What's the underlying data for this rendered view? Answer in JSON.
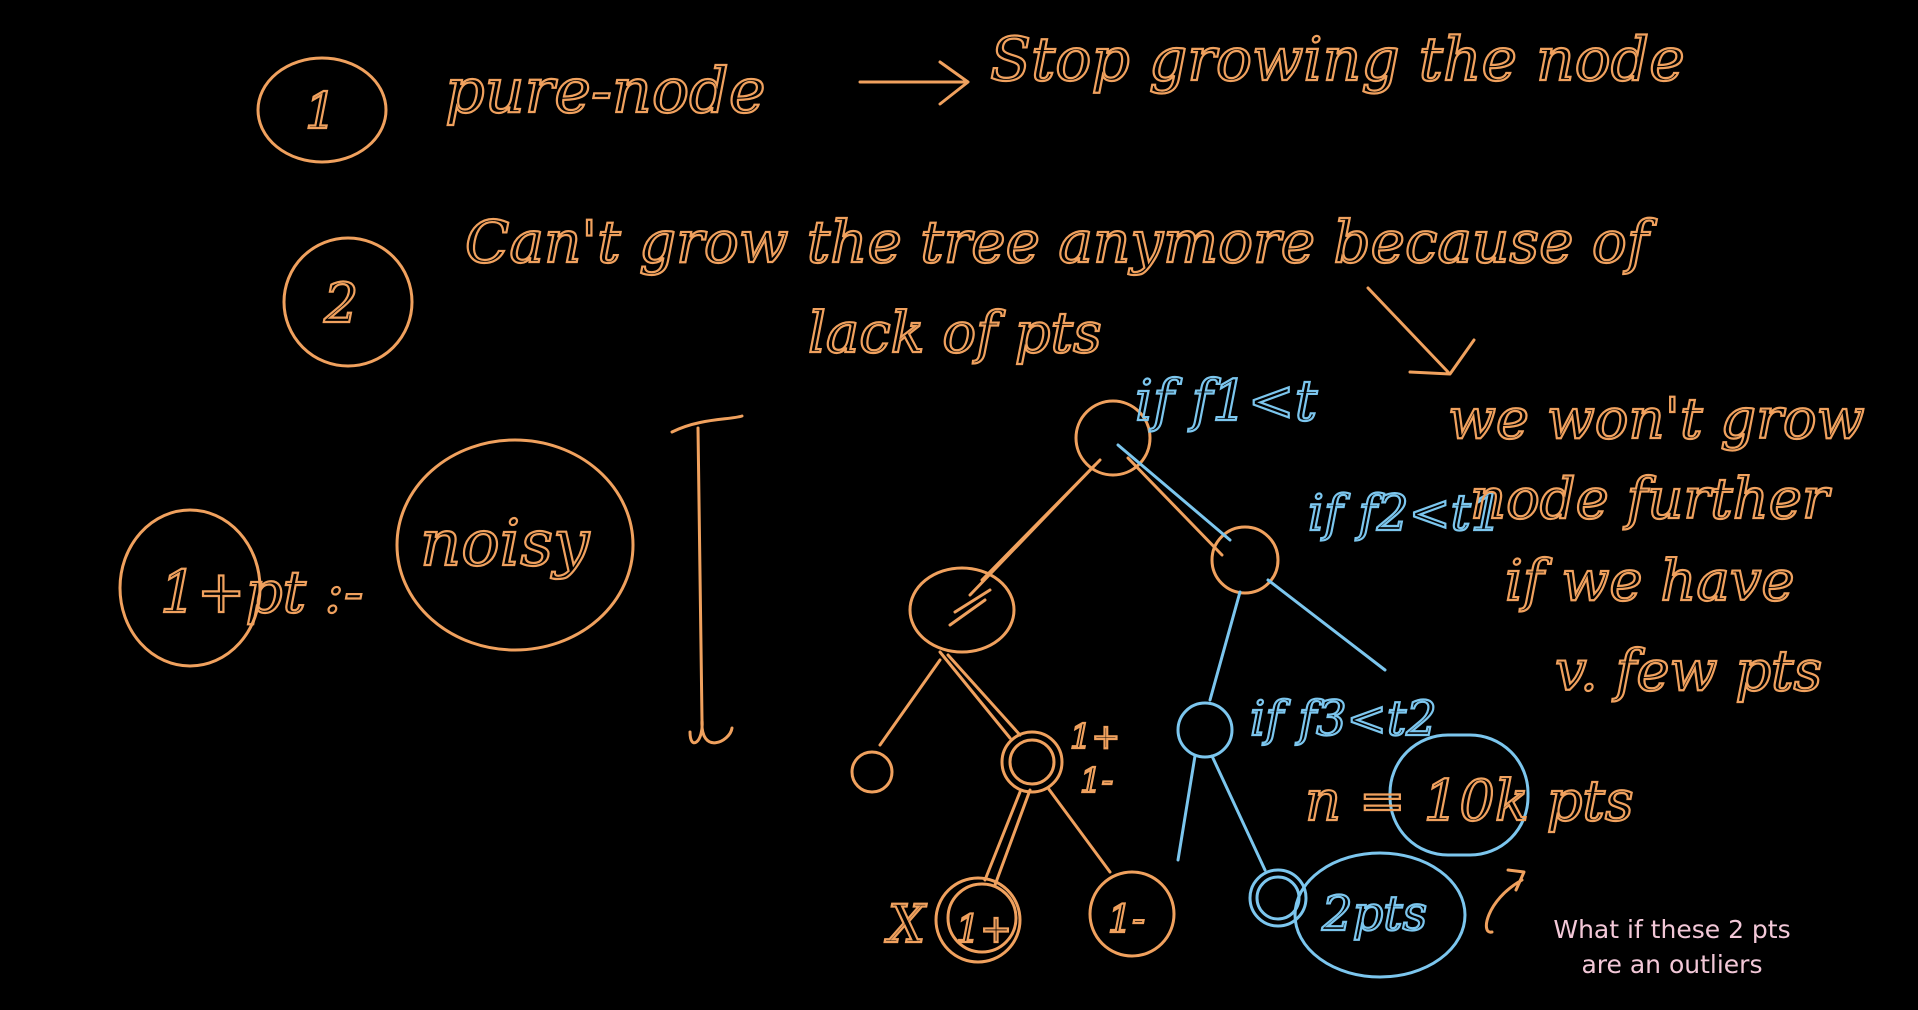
{
  "notes": {
    "n1": "1",
    "pure_node": "pure-node",
    "stop": "Stop growing the node",
    "n2": "2",
    "cant_grow": "Can't grow the tree anymore because of",
    "lack": "lack of pts",
    "one_pt": "1+pt :-",
    "noisy": "noisy",
    "if_f1": "if f1<t",
    "if_f2": "if f2<t1",
    "if_f3": "if f3<t2",
    "wont_grow_1": "we won't grow",
    "wont_grow_2": "node further",
    "wont_grow_3": "if we have",
    "wont_grow_4": "v. few pts",
    "n_pts": "n = 10k pts",
    "leaf_x": "X",
    "leaf_pos": "1+",
    "leaf_neg": "1-",
    "mid_pos": "1+",
    "mid_neg": "1-",
    "two_pts": "2pts"
  },
  "caption": {
    "line1": "What if these 2 pts",
    "line2": "are an outliers"
  },
  "colors": {
    "background": "#000000",
    "orange_ink": "#f0a15e",
    "blue_ink": "#7cc6ee",
    "caption": "#f3c8d8"
  }
}
